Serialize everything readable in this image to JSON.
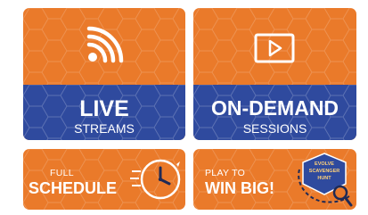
{
  "colors": {
    "orange": "#ea7a2a",
    "blue": "#2f4a9e",
    "text": "#ffffff",
    "dark": "#1f2a55"
  },
  "tiles": {
    "live": {
      "icon": "wifi-broadcast-icon",
      "title": "LIVE",
      "subtitle": "STREAMS"
    },
    "on_demand": {
      "icon": "play-button-icon",
      "title": "ON-DEMAND",
      "subtitle": "SESSIONS"
    },
    "schedule": {
      "icon": "clock-icon",
      "line1": "FULL",
      "line2": "SCHEDULE"
    },
    "play": {
      "icon": "scavenger-hunt-badge-icon",
      "line1": "PLAY TO",
      "line2": "WIN BIG!",
      "badge": {
        "line1": "EVOLVE",
        "line2": "SCAVENGER",
        "line3": "HUNT"
      }
    }
  }
}
